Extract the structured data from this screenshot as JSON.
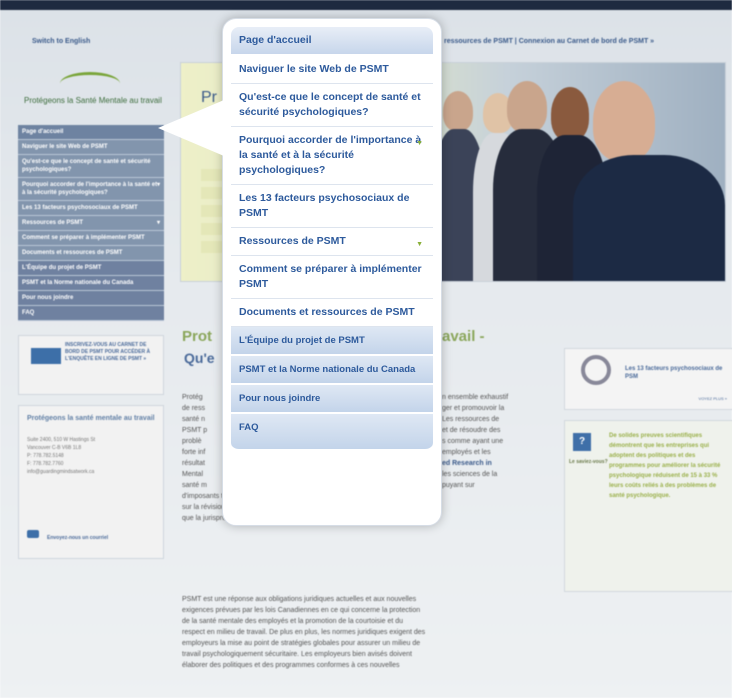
{
  "top_links": {
    "switch_language": "Switch to English",
    "right_links": "ressources de PSMT  |  Connexion au Carnet de bord de PSMT »"
  },
  "logo": {
    "brand": "Protégeons la Santé Mentale au travail"
  },
  "sidebar": {
    "items": [
      {
        "label": "Page d'accueil"
      },
      {
        "label": "Naviguer le site Web de PSMT"
      },
      {
        "label": "Qu'est-ce que le concept de santé et sécurité psychologiques?"
      },
      {
        "label": "Pourquoi accorder de l'importance à la santé et à la sécurité psychologiques?",
        "arrow": "▾"
      },
      {
        "label": "Les 13 facteurs psychosociaux de PSMT"
      },
      {
        "label": "Ressources de PSMT",
        "arrow": "▾"
      },
      {
        "label": "Comment se préparer à implémenter PSMT"
      },
      {
        "label": "Documents et ressources de PSMT"
      },
      {
        "label": "L'Équipe du projet de PSMT"
      },
      {
        "label": "PSMT et la Norme nationale du Canada"
      },
      {
        "label": "Pour nous joindre"
      },
      {
        "label": "FAQ"
      }
    ],
    "promo": "INSCRIVEZ-VOUS AU CARNET DE BORD DE PSMT POUR ACCÉDER À L'ENQUÊTE EN LIGNE DE PSMT »",
    "contact": {
      "title": "Protégeons la santé mentale au travail",
      "lines": [
        "Suite 2400, 510 W Hastings St",
        "Vancouver C-B V6B 1L8",
        "P: 778.782.5148",
        "F: 778.782.7760",
        "info@guardingmindsatwork.ca"
      ],
      "email_cta": "Envoyez-nous un courriel"
    }
  },
  "hero": {
    "partial_title": "Pr"
  },
  "content": {
    "heading_left": "Prot",
    "heading_right": "avail -",
    "subheading": "Qu'e",
    "para1_lines": [
      "Protég",
      "de ress",
      "santé n",
      "PSMT p",
      "problè",
      "forte inf",
      "résultat",
      "Mental",
      "santé m",
      "d'imposants travaux de recherche, incluant l'analyse d'échantillons nationaux,",
      "sur la révision des meilleures pratiques au plan national et international, ainsi",
      "que la jurisprudence et les lois Canadiennes courante et en émergence."
    ],
    "para1_right_lines": [
      "n ensemble exhaustif",
      "ger et promouvoir la",
      "Les ressources de",
      "et de résoudre des",
      "s comme ayant une",
      "employés et les",
      "ed Research in",
      "les sciences de la",
      "puyant sur"
    ],
    "para2_lines": [
      "PSMT est une réponse aux obligations juridiques actuelles et aux nouvelles",
      "exigences prévues par les lois Canadiennes en ce qui concerne la protection",
      "de la santé mentale des employés et la promotion de la courtoisie et du",
      "respect en milieu de travail. De plus en plus, les normes juridiques exigent des",
      "employeurs la mise au point de stratégies globales pour assurer un milieu de",
      "travail psychologiquement sécuritaire. Les employeurs bien avisés doivent",
      "élaborer des politiques et des programmes conformes à ces nouvelles"
    ]
  },
  "right_boxes": {
    "factors_title": "Les 13 facteurs psychosociaux de PSM",
    "factors_more": "VOYEZ PLUS »",
    "question_label": "Le saviez-vous?",
    "question_text": "De solides preuves scientifiques démontrent que les entreprises qui adoptent des politiques et des programmes pour améliorer la sécurité psychologique réduisent de 15 à 33 % leurs coûts reliés à des problèmes de santé psychologique."
  },
  "overlay_menu": {
    "items": [
      {
        "label": "Page d'accueil"
      },
      {
        "label": "Naviguer le site Web de PSMT"
      },
      {
        "label": "Qu'est-ce que le concept de santé et sécurité psychologiques?"
      },
      {
        "label": "Pourquoi accorder de l'importance à la santé et à la sécurité psychologiques?",
        "arrow": "▼"
      },
      {
        "label": "Les 13 facteurs psychosociaux de PSMT"
      },
      {
        "label": "Ressources de PSMT",
        "arrow": "▼"
      },
      {
        "label": "Comment se préparer à implémenter PSMT"
      },
      {
        "label": "Documents et ressources de PSMT"
      },
      {
        "label": "L'Équipe du projet de PSMT"
      },
      {
        "label": "PSMT et la Norme nationale du Canada"
      },
      {
        "label": "Pour nous joindre"
      },
      {
        "label": "FAQ"
      }
    ]
  }
}
